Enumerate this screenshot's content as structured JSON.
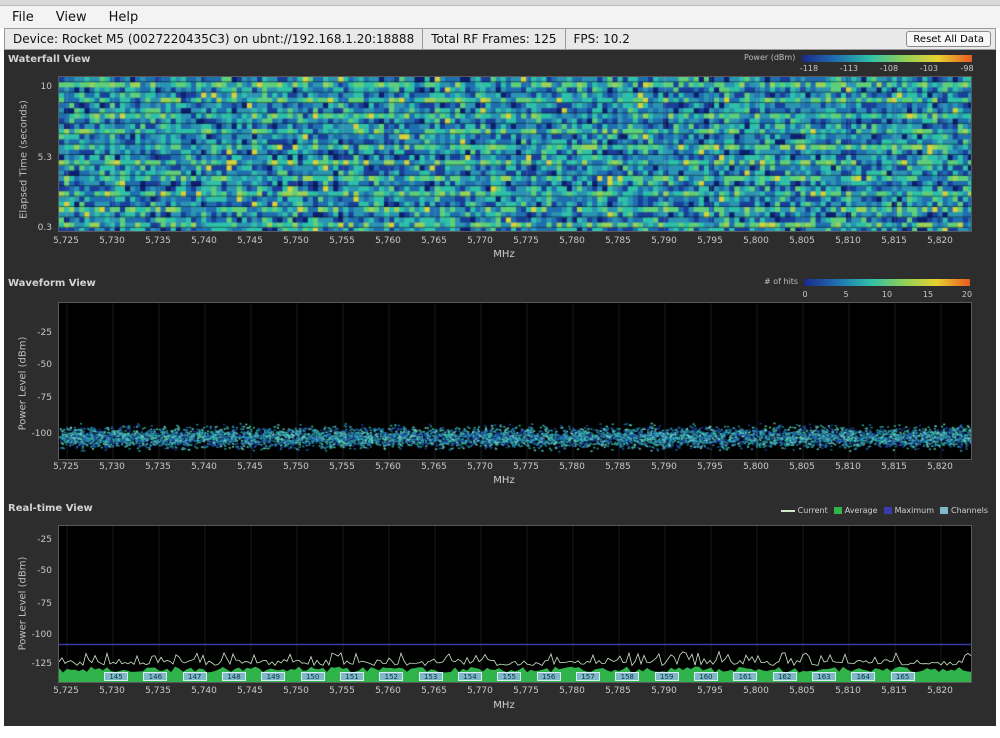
{
  "menu": {
    "items": [
      "File",
      "View",
      "Help"
    ]
  },
  "status": {
    "device": "Device: Rocket M5 (0027220435C3) on ubnt://192.168.1.20:18888",
    "frames": "Total RF Frames: 125",
    "fps": "FPS: 10.2",
    "reset_label": "Reset All Data"
  },
  "freq_ticks": [
    "5,725",
    "5,730",
    "5,735",
    "5,740",
    "5,745",
    "5,750",
    "5,755",
    "5,760",
    "5,765",
    "5,770",
    "5,775",
    "5,780",
    "5,785",
    "5,790",
    "5,795",
    "5,800",
    "5,805",
    "5,810",
    "5,815",
    "5,820"
  ],
  "x_unit": "MHz",
  "waterfall": {
    "title": "Waterfall View",
    "ylabel": "Elapsed Time (seconds)",
    "yticks": [
      "10",
      "5.3",
      "0.3"
    ],
    "legend_label": "Power (dBm)",
    "legend_ticks": [
      "-118",
      "-113",
      "-108",
      "-103",
      "-98"
    ]
  },
  "waveform": {
    "title": "Waveform View",
    "ylabel": "Power Level (dBm)",
    "yticks": [
      "-25",
      "-50",
      "-75",
      "-100"
    ],
    "legend_label": "# of hits",
    "legend_ticks": [
      "0",
      "5",
      "10",
      "15",
      "20"
    ]
  },
  "realtime": {
    "title": "Real-time View",
    "ylabel": "Power Level (dBm)",
    "yticks": [
      "-25",
      "-50",
      "-75",
      "-100",
      "-125"
    ],
    "legend": [
      "Current",
      "Average",
      "Maximum",
      "Channels"
    ],
    "channels": [
      "145",
      "146",
      "147",
      "148",
      "149",
      "150",
      "151",
      "152",
      "153",
      "154",
      "155",
      "156",
      "157",
      "158",
      "159",
      "160",
      "161",
      "162",
      "163",
      "164",
      "165"
    ]
  },
  "colors": {
    "panel_bg": "#2d2d2d",
    "plot_bg": "#000000",
    "average": "#2fb34a",
    "current": "#cfe8c8",
    "maximum": "#3a3aa8",
    "channels": "#7fb8c8"
  },
  "chart_data": [
    {
      "type": "heatmap",
      "title": "Waterfall View",
      "xlabel": "MHz",
      "ylabel": "Elapsed Time (seconds)",
      "xlim": [
        5725,
        5825
      ],
      "ylim": [
        0.3,
        10
      ],
      "color_scale": {
        "label": "Power (dBm)",
        "range": [
          -118,
          -98
        ]
      }
    },
    {
      "type": "scatter",
      "title": "Waveform View",
      "xlabel": "MHz",
      "ylabel": "Power Level (dBm)",
      "xlim": [
        5725,
        5825
      ],
      "ylim": [
        -110,
        -20
      ],
      "color_scale": {
        "label": "# of hits",
        "range": [
          0,
          20
        ]
      },
      "noise_floor_dbm": -103
    },
    {
      "type": "area",
      "title": "Real-time View",
      "xlabel": "MHz",
      "ylabel": "Power Level (dBm)",
      "xlim": [
        5725,
        5825
      ],
      "ylim": [
        -135,
        -15
      ],
      "series": [
        {
          "name": "Average",
          "level_dbm": -124
        },
        {
          "name": "Current",
          "level_dbm": -118
        },
        {
          "name": "Maximum",
          "level_dbm": -105
        }
      ]
    }
  ]
}
